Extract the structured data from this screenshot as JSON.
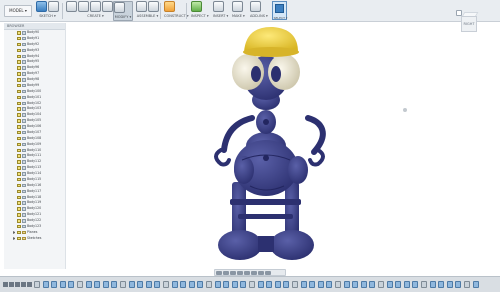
{
  "workspace_button": "MODEL ▾",
  "toolbar_groups": [
    {
      "label": "SKETCH ▾"
    },
    {
      "label": "CREATE ▾"
    },
    {
      "label": "MODIFY ▾"
    },
    {
      "label": "ASSEMBLE ▾"
    },
    {
      "label": "CONSTRUCT ▾"
    },
    {
      "label": "INSPECT ▾"
    },
    {
      "label": "INSERT ▾"
    },
    {
      "label": "MAKE ▾"
    },
    {
      "label": "ADD-INS ▾"
    },
    {
      "label": "SELECT ▾"
    }
  ],
  "browser": {
    "header": "BROWSER",
    "bodies": [
      "Body90",
      "Body91",
      "Body92",
      "Body93",
      "Body94",
      "Body95",
      "Body96",
      "Body97",
      "Body98",
      "Body99",
      "Body100",
      "Body101",
      "Body102",
      "Body103",
      "Body104",
      "Body105",
      "Body106",
      "Body107",
      "Body108",
      "Body109",
      "Body110",
      "Body111",
      "Body112",
      "Body113",
      "Body114",
      "Body115",
      "Body116",
      "Body117",
      "Body118",
      "Body119",
      "Body120",
      "Body121",
      "Body122",
      "Body123"
    ],
    "folders": [
      "Planes",
      "Sketches"
    ]
  },
  "viewcube_face": "RIGHT",
  "colors": {
    "robot_body": "#3a3f82",
    "helmet": "#f1d33a",
    "eyes": "#e8e2d0"
  }
}
